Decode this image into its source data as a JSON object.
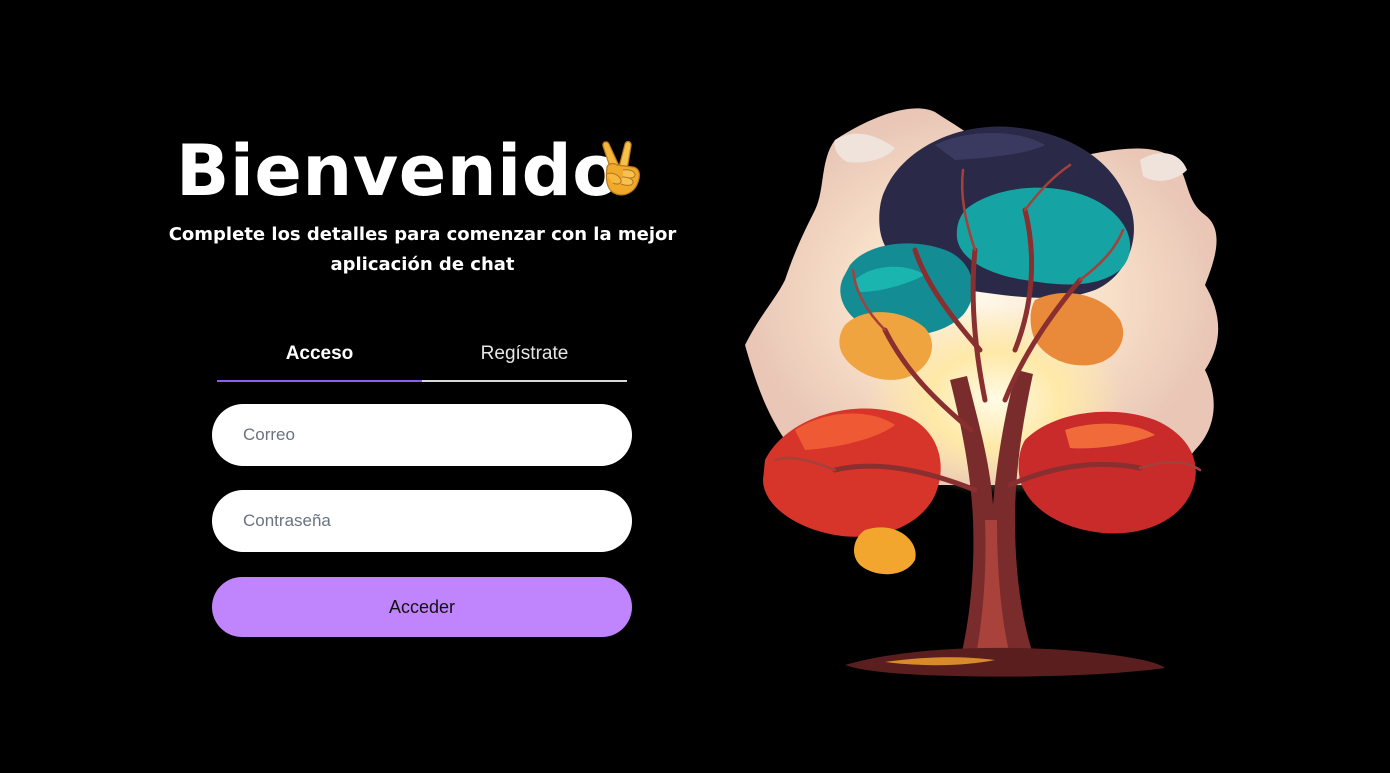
{
  "header": {
    "title": "Bienvenido",
    "title_emoji": "victory-hand-icon",
    "subtitle": "Complete los detalles para comenzar con la mejor aplicación de chat"
  },
  "tabs": [
    {
      "label": "Acceso",
      "active": true
    },
    {
      "label": "Regístrate",
      "active": false
    }
  ],
  "form": {
    "email_placeholder": "Correo",
    "email_value": "",
    "password_placeholder": "Contraseña",
    "password_value": "",
    "submit_label": "Acceder"
  },
  "illustration": {
    "name": "tree-illustration"
  },
  "colors": {
    "background": "#000000",
    "accent": "#c084fc",
    "active_tab_underline": "#8b5cf6",
    "input_background": "#ffffff"
  }
}
